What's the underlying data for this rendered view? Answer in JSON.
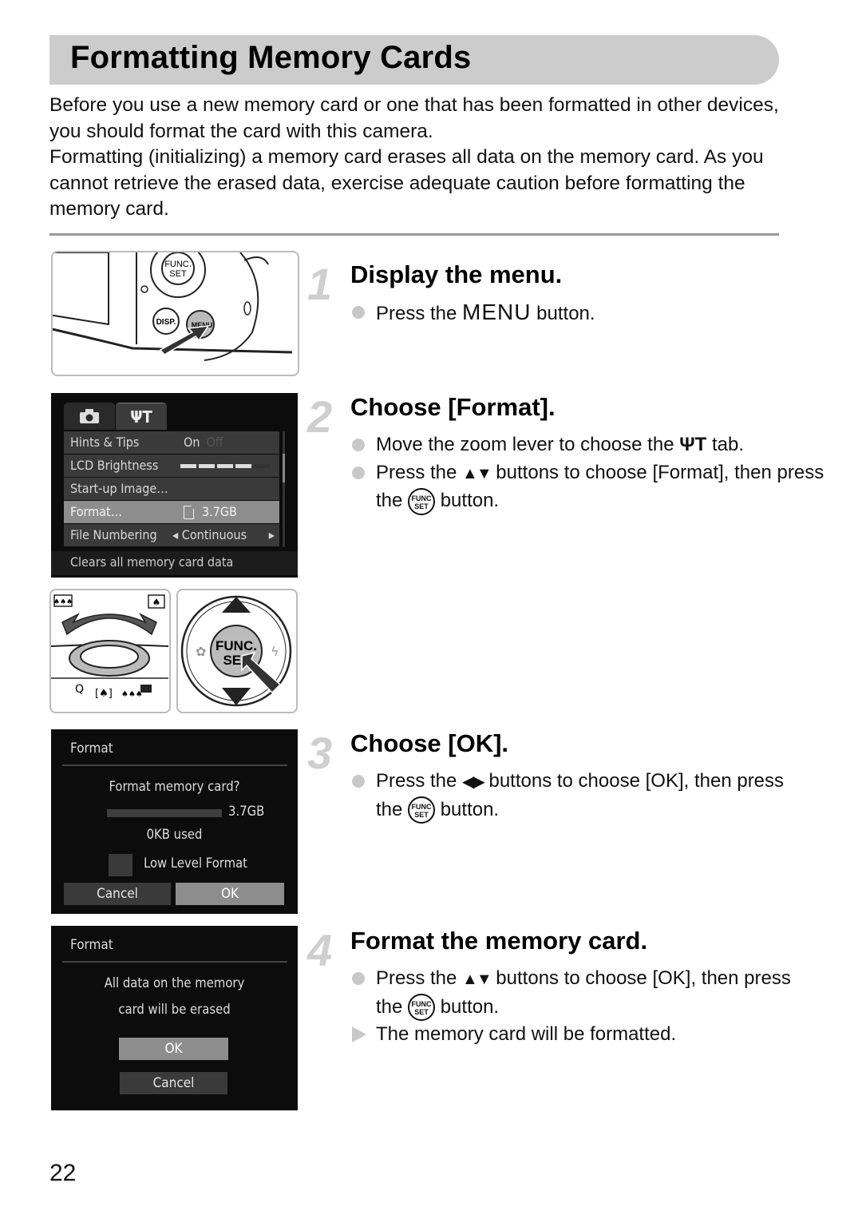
{
  "header": {
    "title": "Formatting Memory Cards"
  },
  "intro": {
    "paragraphs": [
      "Before you use a new memory card or one that has been formatted in other devices, you should format the card with this camera.",
      "Formatting (initializing) a memory card erases all data on the memory card. As you cannot retrieve the erased data, exercise adequate caution before formatting the memory card."
    ]
  },
  "steps": [
    {
      "number": "1",
      "title": "Display the menu.",
      "bullets": [
        {
          "type": "action",
          "before": "Press the ",
          "icon": "MENU",
          "after": " button."
        }
      ]
    },
    {
      "number": "2",
      "title": "Choose [Format].",
      "bullets": [
        {
          "type": "action",
          "before": "Move the zoom lever to choose the ",
          "icon": "ΨT",
          "after": " tab."
        },
        {
          "type": "action",
          "before": "Press the ",
          "icon": "▲▼",
          "after": " buttons to choose [Format], then press the ",
          "icon2": "FUNC. SET",
          "after2": " button."
        }
      ]
    },
    {
      "number": "3",
      "title": "Choose [OK].",
      "bullets": [
        {
          "type": "action",
          "before": "Press the ",
          "icon": "◀▶",
          "after": " buttons to choose [OK], then press the ",
          "icon2": "FUNC. SET",
          "after2": " button."
        }
      ]
    },
    {
      "number": "4",
      "title": "Format the memory card.",
      "bullets": [
        {
          "type": "action",
          "before": "Press the ",
          "icon": "▲▼",
          "after": " buttons to choose [OK], then press the ",
          "icon2": "FUNC. SET",
          "after2": " button."
        },
        {
          "type": "result",
          "text": "The memory card will be formatted."
        }
      ]
    }
  ],
  "camera_illustration": {
    "labels": {
      "func": "FUNC.",
      "set": "SET",
      "disp": "DISP.",
      "menu": "MENU"
    }
  },
  "menu_screen": {
    "tabs": [
      {
        "icon": "camera-icon",
        "glyph": "◘"
      },
      {
        "icon": "tools-icon",
        "glyph": "ΨT"
      }
    ],
    "rows": [
      {
        "label": "Hints & Tips",
        "value": "On",
        "value_dim": "Off"
      },
      {
        "label": "LCD Brightness",
        "value": "",
        "brightness_level": 4,
        "brightness_max": 5
      },
      {
        "label": "Start-up Image…",
        "value": ""
      },
      {
        "label": "Format…",
        "value": "3.7GB",
        "selected": true
      },
      {
        "label": "File Numbering",
        "value": "◂ Continuous",
        "arrow_right": "▸"
      }
    ],
    "help_text": "Clears all memory card data"
  },
  "zoom_illustration": {
    "labels": {
      "wide": "▮▮▮",
      "tele": "[♠]",
      "magnify": "Q",
      "index": "▦"
    }
  },
  "dial_illustration": {
    "labels": {
      "center_line1": "FUNC.",
      "center_line2": "SET",
      "left": "✿",
      "right": "ϟ"
    }
  },
  "format_dialog_1": {
    "title": "Format",
    "question": "Format memory card?",
    "capacity": "3.7GB",
    "used_fraction": 0.0,
    "used": "0KB used",
    "checkbox_label": "Low Level Format",
    "checkbox_checked": false,
    "buttons": {
      "cancel": "Cancel",
      "ok": "OK"
    },
    "selected": "ok"
  },
  "format_dialog_2": {
    "title": "Format",
    "message_line1": "All data on the memory",
    "message_line2": "card will be erased",
    "buttons": {
      "ok": "OK",
      "cancel": "Cancel"
    },
    "selected": "ok"
  },
  "page": {
    "number": "22"
  },
  "colors": {
    "title_bar": "#cccccc",
    "step_number": "#cfcfcf",
    "bullet": "#c8c8c8",
    "divider": "#999999"
  }
}
